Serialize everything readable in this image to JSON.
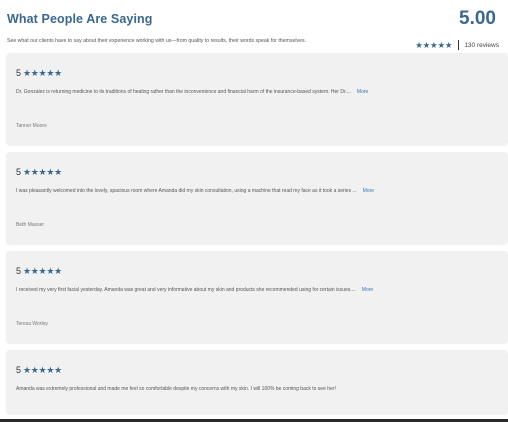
{
  "header": {
    "title": "What People Are Saying",
    "subtitle": "See what our clients have to say about their experience working with us—from quality to results, their words speak for themselves.",
    "average": "5.00",
    "stars": "★★★★★",
    "review_count": "130 reviews"
  },
  "reviews": [
    {
      "rating": "5",
      "stars": "★★★★★",
      "text": "Dr. Gonzalez is returning medicine to its traditions of healing rather than the inconvenience and financial harm of the insurance-based system. Her Dr....",
      "more": "More",
      "author": "Tanner Moore"
    },
    {
      "rating": "5",
      "stars": "★★★★★",
      "text": "I was pleasantly welcomed into the lovely, spacious room where Amanda did my skin consultation, using a machine that read my face as it took a series ...",
      "more": "More",
      "author": "Beth Masser"
    },
    {
      "rating": "5",
      "stars": "★★★★★",
      "text": "I received my very first facial yesterday. Amanda was great and very informative about my skin and products she recommended using for certain issues....",
      "more": "More",
      "author": "Teresa Worley"
    },
    {
      "rating": "5",
      "stars": "★★★★★",
      "text": "Amanda was extremely professional and made me feel so comfortable despite my concerns with my skin. I will 100% be coming back to see her!"
    }
  ],
  "colors": {
    "accent": "#3a6890",
    "link": "#3b74c4",
    "card_bg": "#f1f1f1"
  }
}
